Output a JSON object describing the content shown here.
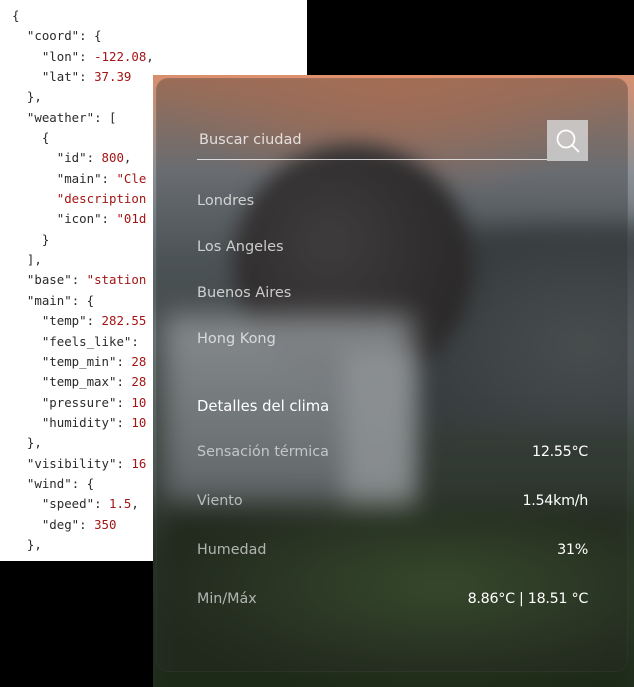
{
  "code_panel": {
    "lines": [
      "{",
      "  \"coord\": {",
      "    \"lon\": -122.08,",
      "    \"lat\": 37.39",
      "  },",
      "  \"weather\": [",
      "    {",
      "      \"id\": 800,",
      "      \"main\": \"Cle",
      "      \"description",
      "      \"icon\": \"01d",
      "    }",
      "  ],",
      "  \"base\": \"station",
      "  \"main\": {",
      "    \"temp\": 282.55",
      "    \"feels_like\":",
      "    \"temp_min\": 28",
      "    \"temp_max\": 28",
      "    \"pressure\": 10",
      "    \"humidity\": 10",
      "  },",
      "  \"visibility\": 16",
      "  \"wind\": {",
      "    \"speed\": 1.5,",
      "    \"deg\": 350",
      "  },"
    ]
  },
  "search": {
    "placeholder": "Buscar ciudad",
    "icon": "search-icon"
  },
  "cities": [
    "Londres",
    "Los Angeles",
    "Buenos Aires",
    "Hong Kong"
  ],
  "details": {
    "title": "Detalles del clima",
    "rows": [
      {
        "label": "Sensación térmica",
        "value": "12.55°C"
      },
      {
        "label": "Viento",
        "value": "1.54km/h"
      },
      {
        "label": "Humedad",
        "value": "31%"
      },
      {
        "label": "Min/Máx",
        "value": "8.86°C | 18.51 °C"
      }
    ]
  },
  "colors": {
    "json_key": "#2b2b2b",
    "json_value": "#a31515",
    "card_overlay": "rgba(40,40,40,0.34)"
  }
}
